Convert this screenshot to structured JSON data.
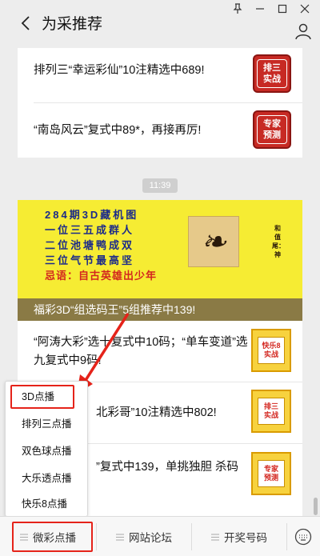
{
  "window": {
    "title": "为采推荐"
  },
  "feed": {
    "top_card": [
      {
        "text": "排列三“幸运彩仙”10注精选中689!",
        "thumb_lines": [
          "排三",
          "实战"
        ]
      },
      {
        "text": "“南岛风云”复式中89*，再接再厉!",
        "thumb_lines": [
          "专家",
          "预测"
        ]
      }
    ],
    "timestamp": "11:39",
    "banner": {
      "lines": [
        "284期3D藏机图",
        "一位三五成群人",
        "二位池塘鸭成双",
        "三位气节最高坚"
      ],
      "motto": "忌语：自古英雄出少年",
      "side_text": "和值尾：神",
      "caption": "福彩3D“组选码王”5组推荐中139!"
    },
    "bottom_card": [
      {
        "text": "“阿涛大彩”选十复式中10码；“单车变道”选九复式中9码!",
        "thumb_lines": [
          "快乐8",
          "实战"
        ]
      },
      {
        "text": "北彩哥”10注精选中802!",
        "thumb_lines": [
          "排三",
          "实战"
        ]
      },
      {
        "text": "”复式中139，单挑独胆 杀码",
        "thumb_lines": [
          "专家",
          "预测"
        ]
      }
    ]
  },
  "menu_popup": {
    "items": [
      "3D点播",
      "排列三点播",
      "双色球点播",
      "大乐透点播",
      "快乐8点播"
    ]
  },
  "bottom_tabs": [
    {
      "label": "微彩点播"
    },
    {
      "label": "网站论坛"
    },
    {
      "label": "开奖号码"
    }
  ],
  "colors": {
    "annotation_red": "#e5231a",
    "banner_yellow": "#f6ec33",
    "caption_olive": "#8a7a45",
    "stamp_red": "#c72a24"
  }
}
